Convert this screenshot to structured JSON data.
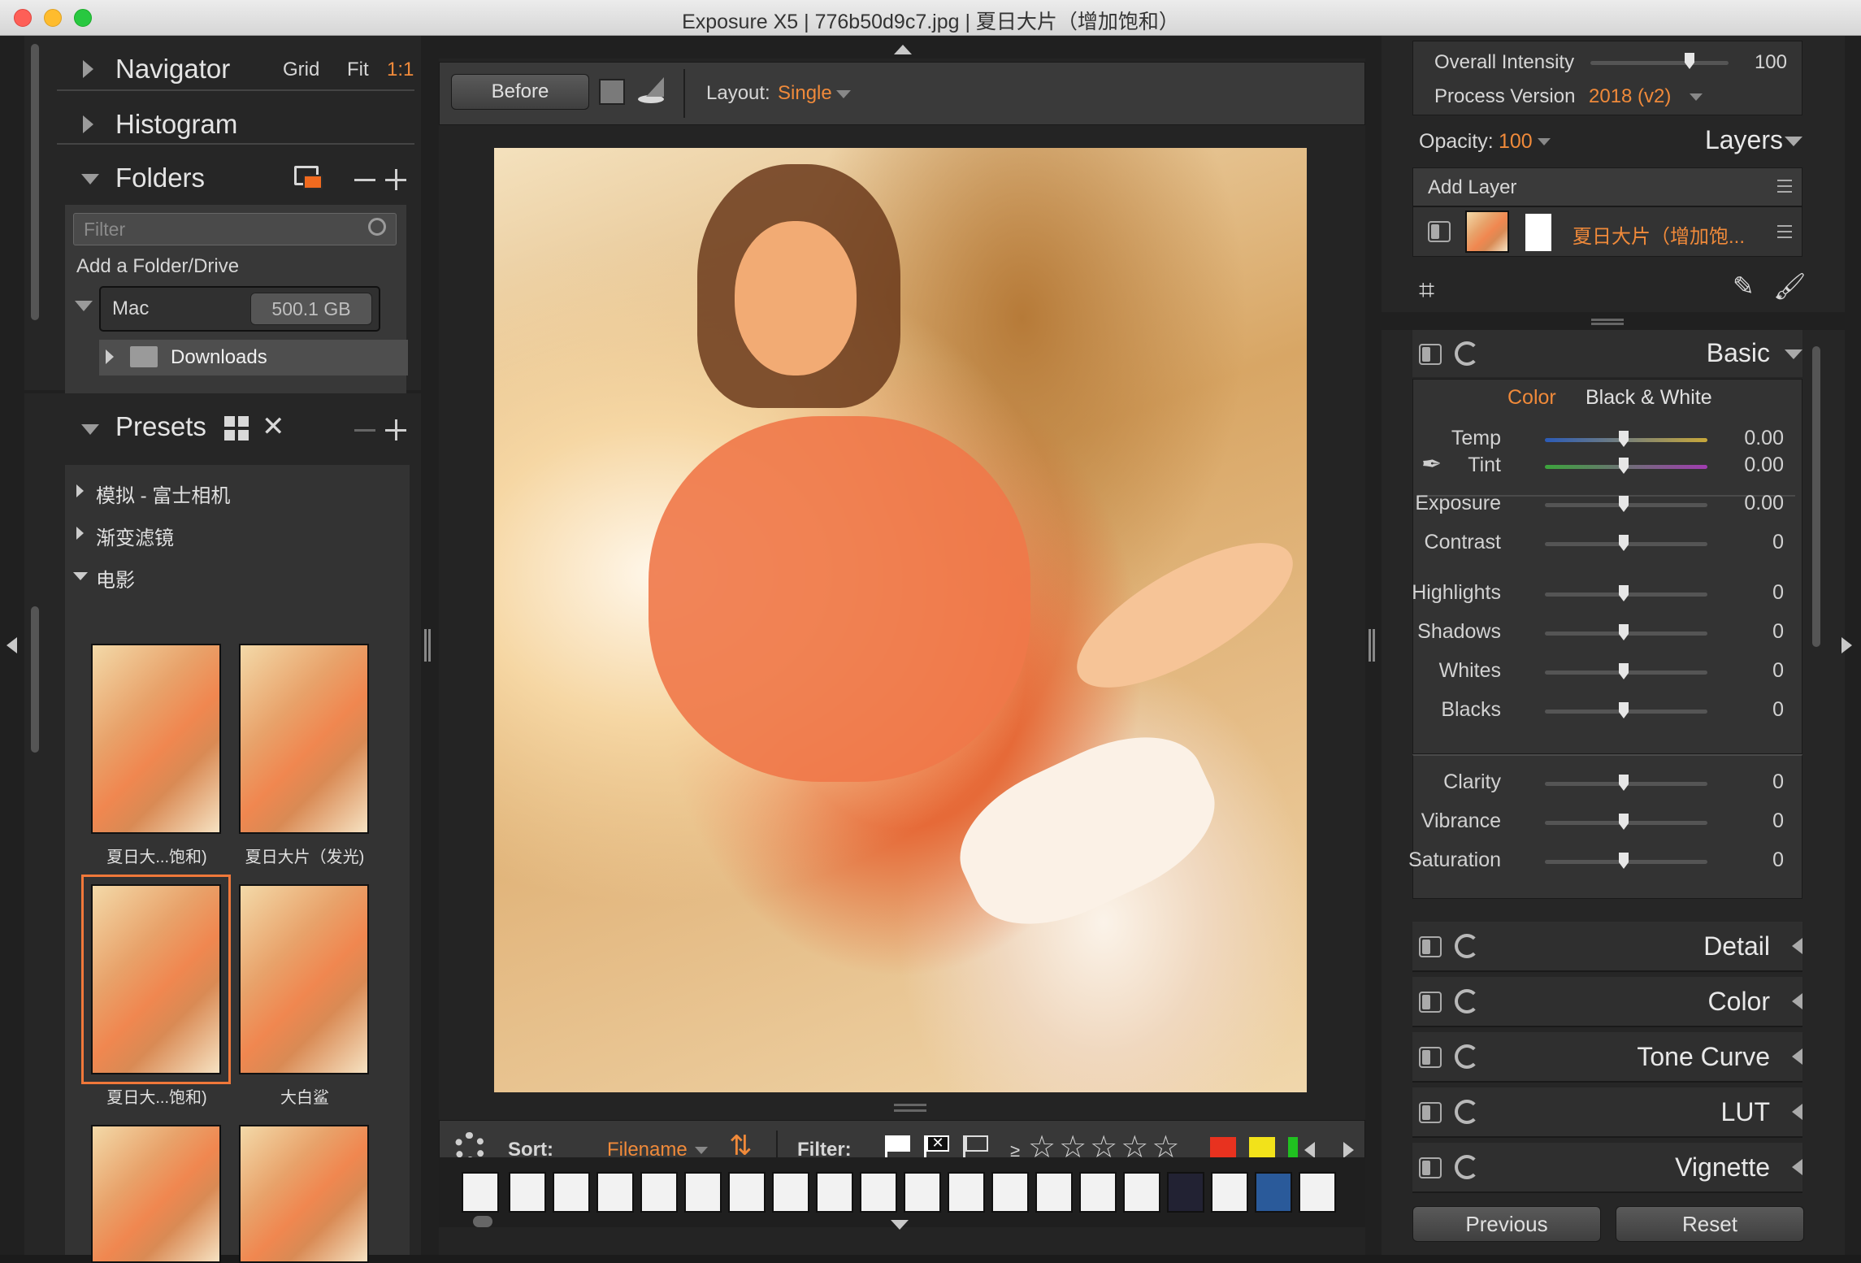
{
  "window": {
    "title": "Exposure X5 | 776b50d9c7.jpg | 夏日大片（增加饱和）"
  },
  "navigator": {
    "label": "Navigator",
    "grid": "Grid",
    "fit": "Fit",
    "one_to_one": "1:1"
  },
  "histogram": {
    "label": "Histogram"
  },
  "folders": {
    "label": "Folders",
    "filter_placeholder": "Filter",
    "add_folder": "Add a Folder/Drive",
    "drive_name": "Mac",
    "drive_size": "500.1 GB",
    "subfolder": "Downloads"
  },
  "presets": {
    "label": "Presets",
    "groups": [
      "模拟 - 富士相机",
      "渐变滤镜",
      "电影"
    ],
    "thumbs": [
      {
        "label": "夏日大...饱和)"
      },
      {
        "label": "夏日大片（发光)"
      },
      {
        "label": "夏日大...饱和)"
      },
      {
        "label": "大白鲨"
      }
    ]
  },
  "toolbar": {
    "before": "Before",
    "layout_label": "Layout:",
    "layout_value": "Single"
  },
  "filmstrip": {
    "sort_label": "Sort:",
    "sort_value": "Filename",
    "filter_label": "Filter:",
    "ge": "≥",
    "stars": [
      "☆",
      "☆",
      "☆",
      "☆",
      "☆"
    ],
    "colors": [
      "#e8321f",
      "#f2e21a",
      "#20c020"
    ]
  },
  "right": {
    "overall_intensity_label": "Overall Intensity",
    "overall_intensity_value": "100",
    "overall_intensity_fraction": 1.0,
    "process_version_label": "Process Version",
    "process_version_value": "2018 (v2)",
    "opacity_label": "Opacity:",
    "opacity_value": "100",
    "layers_label": "Layers",
    "add_layer": "Add Layer",
    "layer_name": "夏日大片（增加饱...",
    "basic": {
      "label": "Basic",
      "tab_color": "Color",
      "tab_bw": "Black & White",
      "sliders": [
        {
          "label": "Temp",
          "value": "0.00"
        },
        {
          "label": "Tint",
          "value": "0.00"
        },
        {
          "label": "Exposure",
          "value": "0.00"
        },
        {
          "label": "Contrast",
          "value": "0"
        },
        {
          "label": "Highlights",
          "value": "0"
        },
        {
          "label": "Shadows",
          "value": "0"
        },
        {
          "label": "Whites",
          "value": "0"
        },
        {
          "label": "Blacks",
          "value": "0"
        },
        {
          "label": "Clarity",
          "value": "0"
        },
        {
          "label": "Vibrance",
          "value": "0"
        },
        {
          "label": "Saturation",
          "value": "0"
        }
      ]
    },
    "sections": [
      "Detail",
      "Color",
      "Tone Curve",
      "LUT",
      "Vignette"
    ],
    "previous": "Previous",
    "reset": "Reset"
  }
}
